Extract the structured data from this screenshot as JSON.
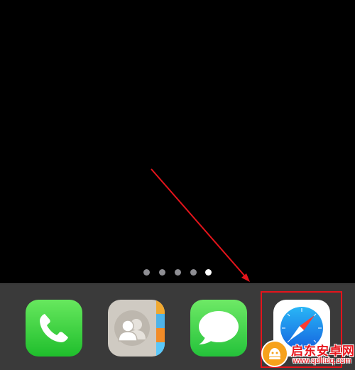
{
  "page_indicator": {
    "total": 5,
    "current": 5
  },
  "dock": {
    "apps": [
      {
        "id": "phone",
        "icon": "phone-handset-icon"
      },
      {
        "id": "contacts",
        "icon": "contacts-people-icon"
      },
      {
        "id": "messages",
        "icon": "speech-bubble-icon"
      },
      {
        "id": "safari",
        "icon": "compass-icon",
        "highlighted": true
      }
    ]
  },
  "annotation": {
    "color": "#e4141b",
    "target": "safari"
  },
  "watermark": {
    "title": "启东安卓网",
    "url": "www.qdlitdq.com"
  },
  "colors": {
    "dock": "#3a3a3a",
    "phone": "#34c759",
    "messages": "#34c759",
    "safari_blue": "#1a8cf0",
    "contact_tabs": [
      "#f0a830",
      "#4fb3e8",
      "#f28c28",
      "#5ac8fa"
    ]
  }
}
